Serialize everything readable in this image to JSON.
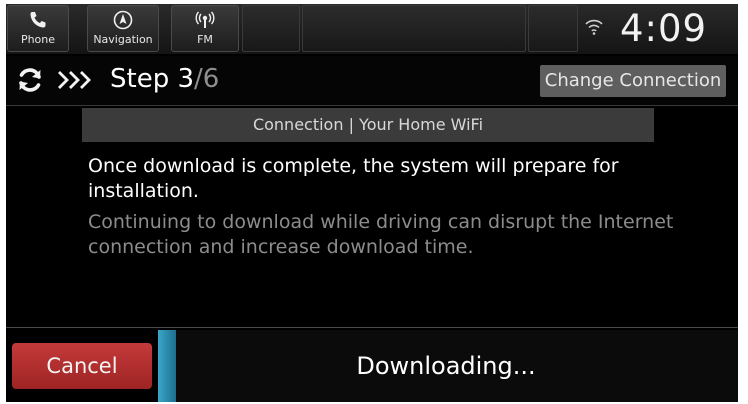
{
  "topbar": {
    "tabs": [
      {
        "label": "Phone",
        "icon": "phone-icon"
      },
      {
        "label": "Navigation",
        "icon": "navigation-icon"
      },
      {
        "label": "FM",
        "icon": "radio-icon"
      }
    ],
    "clock": "4:09",
    "signal_icon": "wifi-signal-icon"
  },
  "header": {
    "step_label": "Step 3",
    "step_total": "/6",
    "change_connection_label": "Change Connection"
  },
  "connection_banner": "Connection | Your Home WiFi",
  "messages": {
    "primary": "Once download is complete, the system will prepare for installation.",
    "secondary": "Continuing to download while driving can disrupt the Internet connection and increase download time."
  },
  "footer": {
    "cancel_label": "Cancel",
    "status": "Downloading..."
  },
  "colors": {
    "cancel": "#b32e2e",
    "accent": "#3aa7c9",
    "banner": "#3b3b3b"
  }
}
